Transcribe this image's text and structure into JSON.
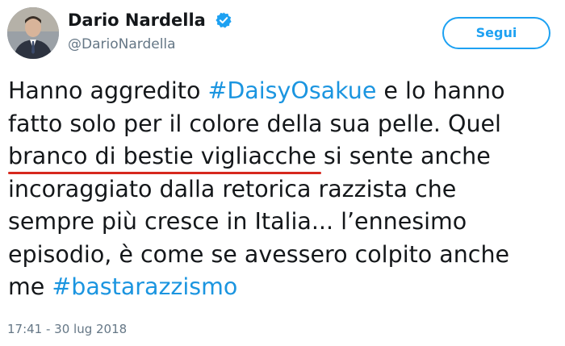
{
  "author": {
    "display_name": "Dario Nardella",
    "handle": "@DarioNardella",
    "verified_icon": "verified-badge-icon"
  },
  "follow_button": {
    "label": "Segui"
  },
  "tweet": {
    "line1_text": "Hanno aggredito ",
    "line1_hashtag": "#DaisyOsakue",
    "line1_text_end": " e lo hanno",
    "line2": "fatto solo per il colore della sua pelle. Quel",
    "line3_underlined": "branco di bestie vigliacche",
    "line3_rest": " si sente anche",
    "line4": "incoraggiato dalla retorica razzista che",
    "line5": "sempre più cresce in Italia... l’ennesimo",
    "line6": "episodio, è come se avessero colpito anche",
    "line7_text": "me ",
    "line7_hashtag": "#bastarazzismo"
  },
  "timestamp": "17:41 - 30 lug 2018",
  "colors": {
    "accent": "#1da1f2",
    "hashtag": "#1b95e0",
    "underline_mark": "#d7281e",
    "secondary_text": "#657786"
  }
}
